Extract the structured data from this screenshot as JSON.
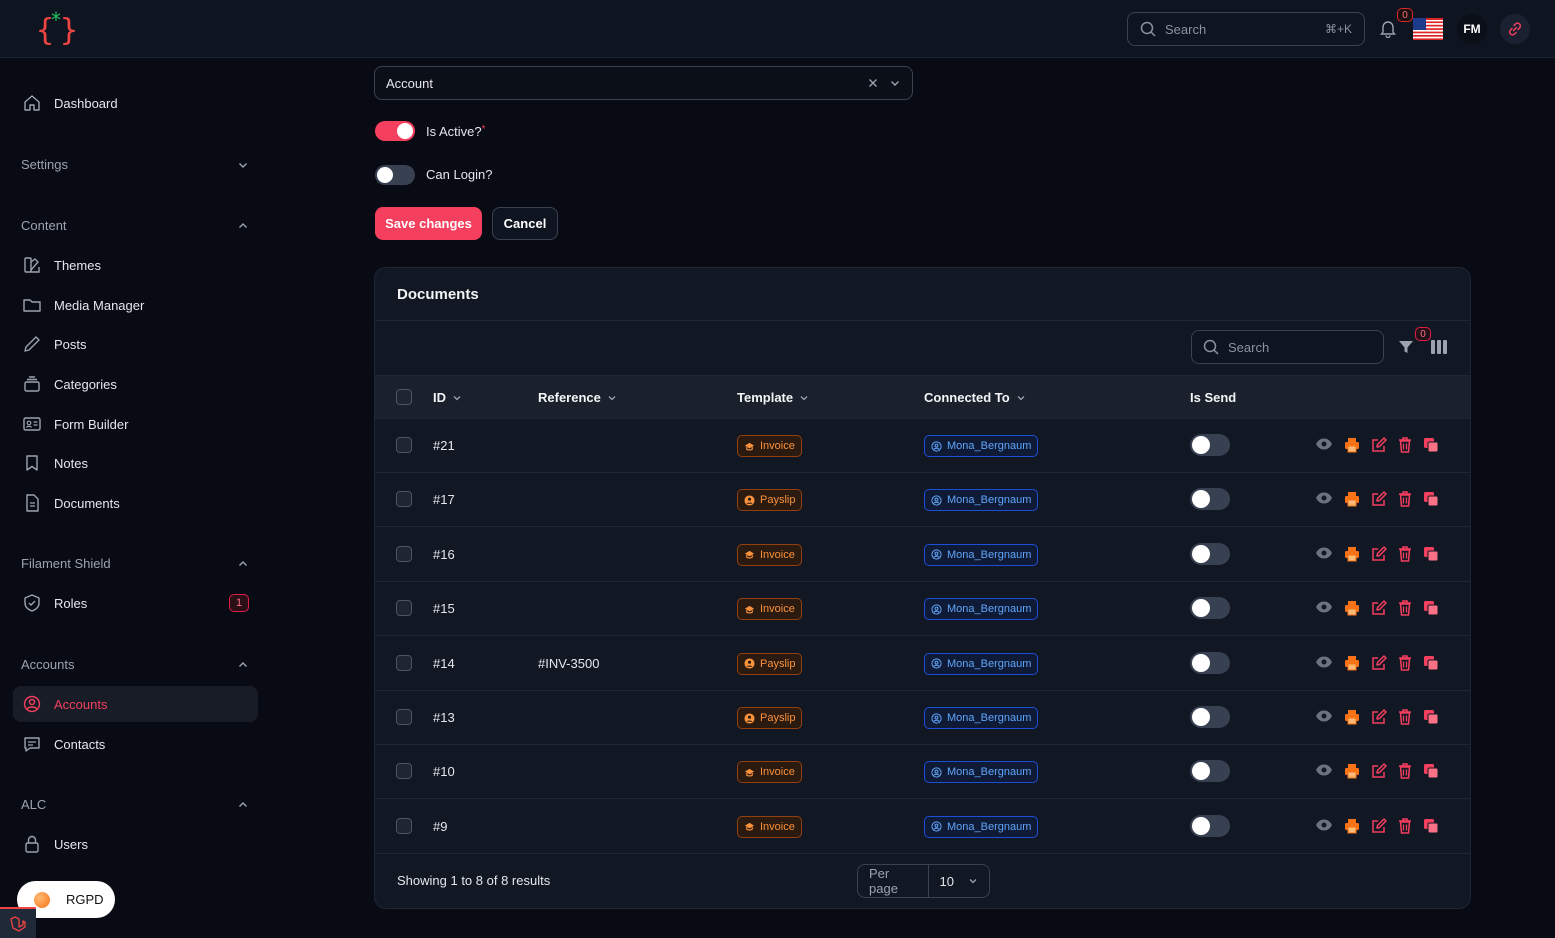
{
  "header": {
    "search_placeholder": "Search",
    "search_shortcut": "⌘+K",
    "notifications_count": "0",
    "user_initials": "FM"
  },
  "sidebar": {
    "dashboard": "Dashboard",
    "settings": "Settings",
    "content_group": "Content",
    "themes": "Themes",
    "media_manager": "Media Manager",
    "posts": "Posts",
    "categories": "Categories",
    "form_builder": "Form Builder",
    "notes": "Notes",
    "documents": "Documents",
    "shield_group": "Filament Shield",
    "roles": "Roles",
    "roles_badge": "1",
    "accounts_group": "Accounts",
    "accounts": "Accounts",
    "contacts": "Contacts",
    "alc_group": "ALC",
    "users": "Users",
    "rgpd": "RGPD"
  },
  "form": {
    "account_value": "Account",
    "is_active_label": "Is Active?",
    "is_active_required": "*",
    "can_login_label": "Can Login?",
    "save_label": "Save changes",
    "cancel_label": "Cancel"
  },
  "documents": {
    "title": "Documents",
    "search_placeholder": "Search",
    "filter_count": "0",
    "columns": {
      "id": "ID",
      "reference": "Reference",
      "template": "Template",
      "connected_to": "Connected To",
      "is_send": "Is Send"
    },
    "rows": [
      {
        "id": "#21",
        "reference": "",
        "template": "Invoice",
        "connected": "Mona_Bergnaum"
      },
      {
        "id": "#17",
        "reference": "",
        "template": "Payslip",
        "connected": "Mona_Bergnaum"
      },
      {
        "id": "#16",
        "reference": "",
        "template": "Invoice",
        "connected": "Mona_Bergnaum"
      },
      {
        "id": "#15",
        "reference": "",
        "template": "Invoice",
        "connected": "Mona_Bergnaum"
      },
      {
        "id": "#14",
        "reference": "#INV-3500",
        "template": "Payslip",
        "connected": "Mona_Bergnaum"
      },
      {
        "id": "#13",
        "reference": "",
        "template": "Payslip",
        "connected": "Mona_Bergnaum"
      },
      {
        "id": "#10",
        "reference": "",
        "template": "Invoice",
        "connected": "Mona_Bergnaum"
      },
      {
        "id": "#9",
        "reference": "",
        "template": "Invoice",
        "connected": "Mona_Bergnaum"
      }
    ],
    "footer_text": "Showing 1 to 8 of 8 results",
    "per_page_label": "Per page",
    "per_page_value": "10"
  },
  "colors": {
    "accent": "#f43f5e",
    "template_badge": "#fb923c",
    "connected_badge": "#60a5fa"
  }
}
